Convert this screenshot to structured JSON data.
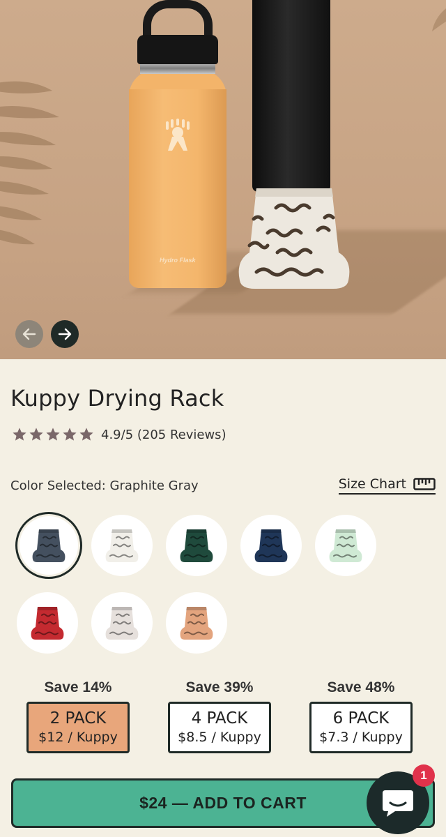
{
  "gallery": {
    "bottle_brand": "Hydro Flask"
  },
  "product": {
    "title": "Kuppy Drying Rack",
    "rating_text": "4.9/5 (205 Reviews)",
    "rating_value": 4.9,
    "rating_max": 5,
    "stars_filled": 5
  },
  "color": {
    "label": "Color Selected:",
    "selected": "Graphite Gray",
    "size_chart_label": "Size Chart",
    "swatches": [
      {
        "name": "Graphite Gray",
        "hex": "#44505f",
        "selected": true
      },
      {
        "name": "White",
        "hex": "#f1efe9"
      },
      {
        "name": "Forest Green",
        "hex": "#1f4a3c"
      },
      {
        "name": "Navy",
        "hex": "#1f3658"
      },
      {
        "name": "Mint",
        "hex": "#cfe9d4"
      },
      {
        "name": "Red",
        "hex": "#c42a30"
      },
      {
        "name": "Light Gray",
        "hex": "#e6e0dc"
      },
      {
        "name": "Peach",
        "hex": "#e3a47e"
      }
    ]
  },
  "packs": [
    {
      "save": "Save 14%",
      "title": "2 PACK",
      "price": "$12 / Kuppy",
      "active": true
    },
    {
      "save": "Save 39%",
      "title": "4 PACK",
      "price": "$8.5 / Kuppy",
      "active": false
    },
    {
      "save": "Save 48%",
      "title": "6 PACK",
      "price": "$7.3 / Kuppy",
      "active": false
    }
  ],
  "cart": {
    "label": "$24 — ADD TO CART"
  },
  "chat": {
    "badge_count": "1"
  },
  "colors": {
    "background": "#f4f0e4",
    "accent_dark": "#1f2a27",
    "cart_green": "#4cb393",
    "pack_active": "#e8a67b",
    "badge_red": "#e0324b"
  }
}
